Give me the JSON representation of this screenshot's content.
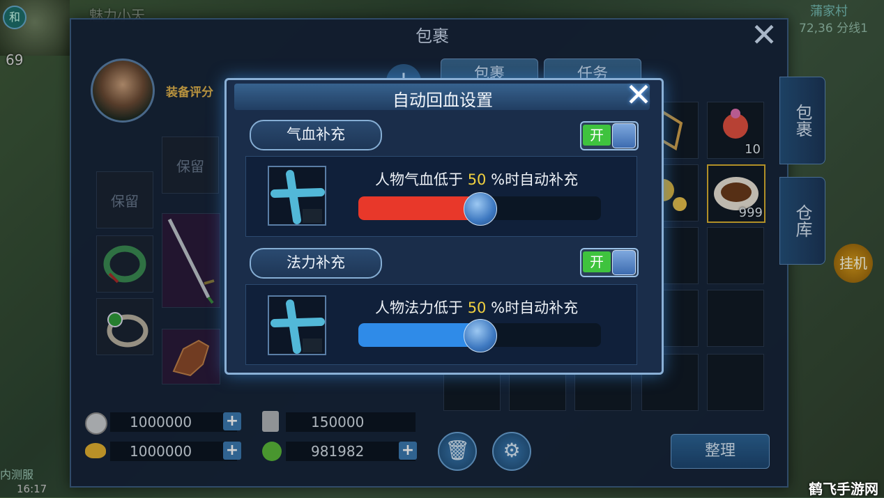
{
  "hud": {
    "badge": "和",
    "level": "69",
    "name": "魅力小天",
    "map": "蒲家村",
    "line": "72,36 分线1",
    "status": "内测服",
    "time": "16:17"
  },
  "bag_panel": {
    "title": "包裹",
    "close_icon": "close-icon",
    "equip_score_label": "装备评分",
    "reserved_label": "保留",
    "tabs": [
      "包裹",
      "任务"
    ],
    "side_tabs": [
      "包裹",
      "仓库"
    ],
    "items": [
      {
        "icon": "peach-icon",
        "qty": "10"
      },
      {
        "icon": "dish-icon",
        "qty": "999"
      }
    ],
    "currencies": [
      {
        "icon": "coin-icon",
        "value": "1000000"
      },
      {
        "icon": "scroll-icon",
        "value": "150000"
      },
      {
        "icon": "gold-ingot-icon",
        "value": "1000000"
      },
      {
        "icon": "jade-icon",
        "value": "981982"
      }
    ],
    "sort_label": "整理",
    "hang_label": "挂机"
  },
  "auto_heal": {
    "title": "自动回血设置",
    "hp": {
      "label": "气血补充",
      "toggle": "开",
      "text_prefix": "人物气血低于",
      "threshold": "50",
      "text_suffix": "%时自动补充",
      "level": 0.5,
      "color": "#e8382a"
    },
    "mp": {
      "label": "法力补充",
      "toggle": "开",
      "text_prefix": "人物法力低于",
      "threshold": "50",
      "text_suffix": "%时自动补充",
      "level": 0.5,
      "color": "#2f8be8"
    }
  },
  "watermark": "鹤飞手游网"
}
